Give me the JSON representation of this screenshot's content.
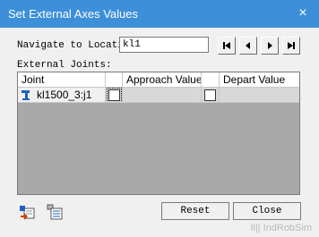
{
  "window": {
    "title": "Set External Axes Values",
    "close_glyph": "×"
  },
  "navigate": {
    "label": "Navigate to Location",
    "value": "kl1",
    "buttons": [
      "first",
      "previous",
      "next",
      "last"
    ]
  },
  "external_joints": {
    "label": "External Joints:",
    "columns": [
      "Joint",
      "",
      "Approach Value",
      "",
      "Depart Value"
    ],
    "rows": [
      {
        "joint": "kl1500_3:j1",
        "approach_checked": false,
        "approach_value": "",
        "depart_checked": false,
        "depart_value": ""
      }
    ]
  },
  "footer": {
    "reset_label": "Reset",
    "close_label": "Close",
    "icons": [
      "teach-icon",
      "list-icon"
    ]
  },
  "watermark": "Il|| IndRobSim"
}
